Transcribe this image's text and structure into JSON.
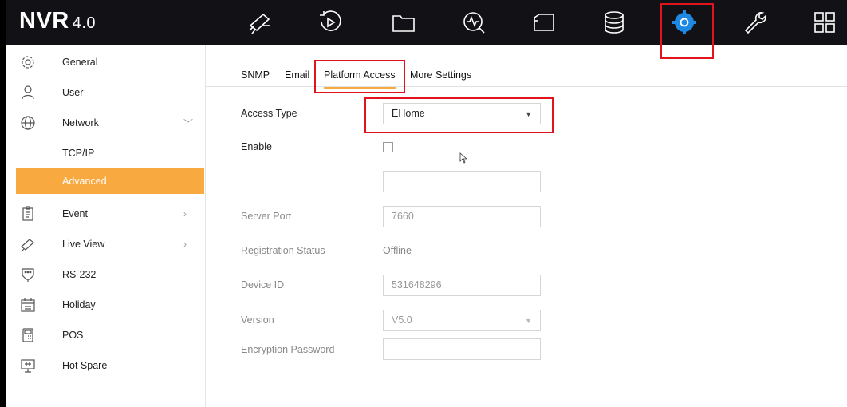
{
  "brand": {
    "name": "NVR",
    "version": "4.0"
  },
  "topnav": [
    {
      "name": "live-view-icon"
    },
    {
      "name": "playback-icon"
    },
    {
      "name": "file-management-icon"
    },
    {
      "name": "smart-analysis-icon"
    },
    {
      "name": "camera-icon"
    },
    {
      "name": "storage-icon"
    },
    {
      "name": "configuration-gear-icon",
      "selected": true
    },
    {
      "name": "maintenance-wrench-icon"
    },
    {
      "name": "menu-grid-icon"
    }
  ],
  "sidebar": {
    "items": [
      {
        "label": "General",
        "icon": "general-icon"
      },
      {
        "label": "User",
        "icon": "user-icon"
      },
      {
        "label": "Network",
        "icon": "network-globe-icon",
        "arrow": "﹀"
      },
      {
        "label": "TCP/IP"
      },
      {
        "label": "Advanced"
      },
      {
        "label": "Event",
        "icon": "event-icon",
        "arrow": "›"
      },
      {
        "label": "Live View",
        "icon": "live-view-icon",
        "arrow": "›"
      },
      {
        "label": "RS-232",
        "icon": "rs232-icon"
      },
      {
        "label": "Holiday",
        "icon": "holiday-calendar-icon"
      },
      {
        "label": "POS",
        "icon": "pos-icon"
      },
      {
        "label": "Hot Spare",
        "icon": "hot-spare-icon"
      }
    ]
  },
  "tabs": [
    "SNMP",
    "Email",
    "Platform Access",
    "More Settings"
  ],
  "form": {
    "access_type_label": "Access Type",
    "access_type_value": "EHome",
    "enable_label": "Enable",
    "server_address_value": "",
    "server_port_label": "Server Port",
    "server_port_value": "7660",
    "registration_status_label": "Registration Status",
    "registration_status_value": "Offline",
    "device_id_label": "Device ID",
    "device_id_value": "531648296",
    "version_label": "Version",
    "version_value": "V5.0",
    "encryption_password_label": "Encryption Password",
    "encryption_password_value": ""
  },
  "colors": {
    "accent": "#f8a940",
    "highlight": "#e1141c",
    "gear": "#1e88e5",
    "topbar": "#121216"
  }
}
